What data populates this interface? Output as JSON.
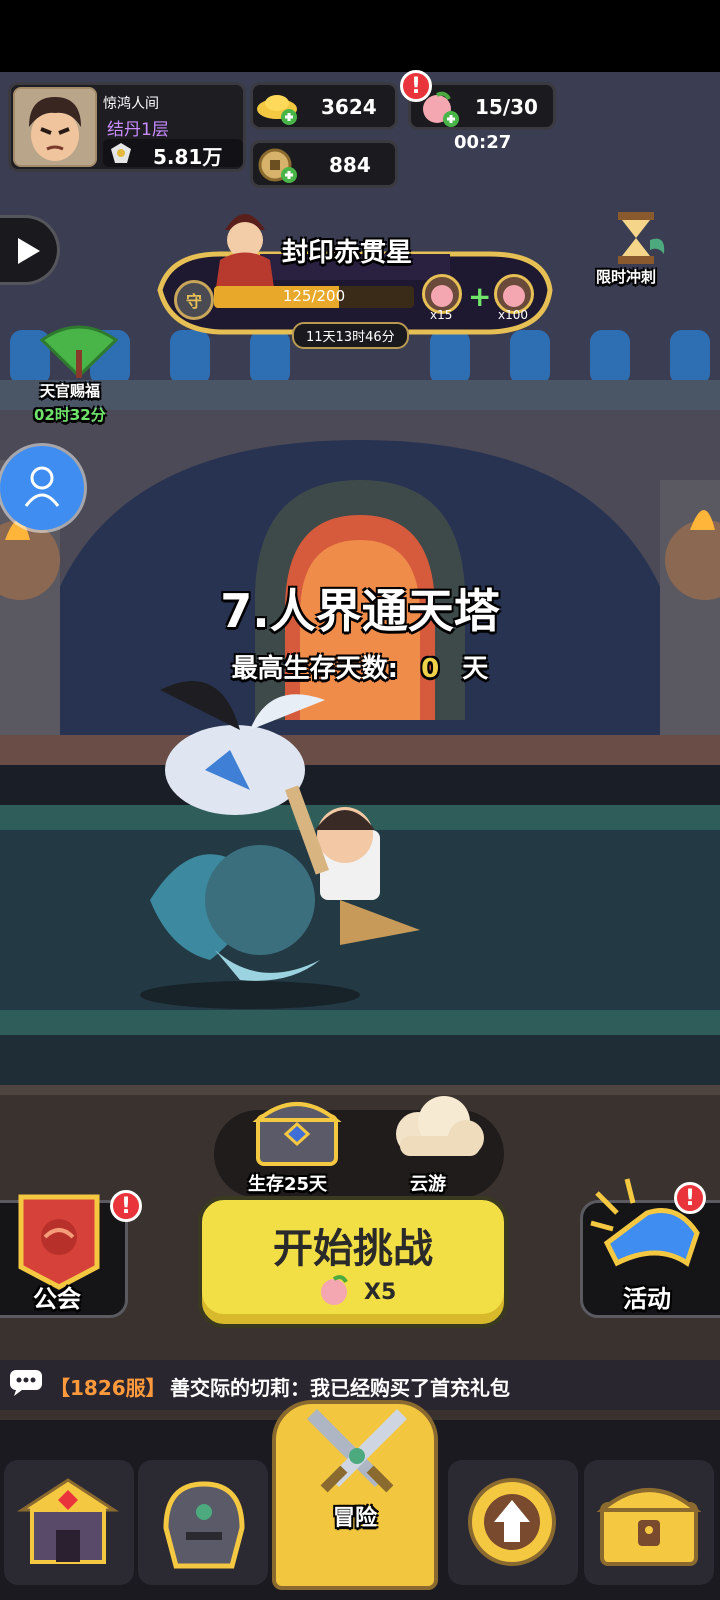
{
  "player": {
    "name": "惊鸿人间",
    "realm": "结丹1层",
    "power": "5.81万"
  },
  "resources": {
    "gold": "3624",
    "coins": "884",
    "stamina": "15/30",
    "stamina_timer": "00:27"
  },
  "event_banner": {
    "title": "封印赤贯星",
    "progress_text": "125/200",
    "progress_fraction": 0.625,
    "shield_glyph": "守",
    "reward1_qty": "x15",
    "reward2_qty": "x100",
    "countdown": "11天13时46分"
  },
  "side_left": {
    "blessing_label": "天官赐福",
    "blessing_timer": "02时32分"
  },
  "side_right": {
    "limited_label": "限时冲刺"
  },
  "stage": {
    "title": "7.人界通天塔",
    "best_label": "最高生存天数:",
    "best_value": "0",
    "best_unit": "天"
  },
  "mid_buttons": {
    "chest_label": "生存25天",
    "cloud_label": "云游"
  },
  "actions": {
    "guild_label": "公会",
    "start_label": "开始挑战",
    "start_cost": "X5",
    "activity_label": "活动",
    "alert_mark": "!"
  },
  "chat": {
    "server_tag": "【1826服】",
    "message": "善交际的切莉：我已经购买了首充礼包"
  },
  "bottom_nav": {
    "adventure_label": "冒险"
  },
  "colors": {
    "gold": "#f5c842",
    "accent_yellow": "#f0d24a",
    "progress": "#e8a92a",
    "alert_red": "#e8343a",
    "purple_text": "#c98cff",
    "green_text": "#6fe36a",
    "chat_orange": "#ff9a3c"
  }
}
